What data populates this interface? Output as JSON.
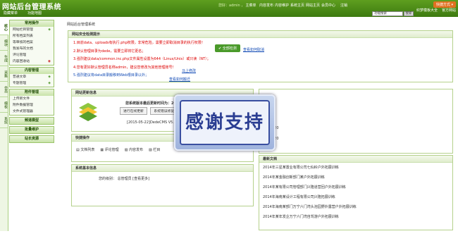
{
  "header": {
    "logo": "网站后台管理系统",
    "subnav": [
      "隐藏菜单",
      "功能地图"
    ],
    "user": "您好：admin ，",
    "nav": [
      "主菜单",
      "内容发布",
      "内容维护",
      "系统主页",
      "网站主页",
      "会员中心",
      "注销"
    ],
    "quick_label": "快捷方式 ▾",
    "quick_links": [
      "织梦模板大全",
      "官方网站"
    ],
    "search_value": "功能搜索",
    "search_button": "搜索"
  },
  "left_tabs": [
    "核心",
    "模块",
    "生成",
    "采集",
    "会员",
    "模板",
    "系统"
  ],
  "sidebar": [
    {
      "title": "常用操作",
      "items": [
        "网站栏目管理",
        "所有档案列表",
        "等审核的档案",
        "我发布的文档",
        "评论管理",
        "内容回收站"
      ]
    },
    {
      "title": "内容管理",
      "items": [
        "普通文章",
        "专题管理"
      ]
    },
    {
      "title": "附件管理",
      "items": [
        "上传新文件",
        "附件数据管理",
        "文件式管理器"
      ]
    },
    {
      "title": "频道模型",
      "items": []
    },
    {
      "title": "批量维护",
      "items": []
    },
    {
      "title": "站长资源",
      "items": []
    }
  ],
  "breadcrumb": "网站后台管理系统",
  "security": {
    "title": "网站安全检测提示",
    "lines": [
      "1.目前data、uploads有执行.php权限，非常危险，需要立即取消目录的执行权限！",
      "2.默认管理目录为dede，需要立即将它更名；",
      "3.强烈建议data/common.inc.php文件属性设置为644（Linux/Unix）或只读（NT）；",
      "4.您有更好默认管理员名称admin，建议您修改为其他管理账号！",
      "5.强烈建议将data目录搬移到Web根目录以外；"
    ],
    "fix_links": [
      "马上修改",
      "查看如何搬迁"
    ],
    "ok_button": "✔ 全部检测",
    "howto": "查看如何取消"
  },
  "updates": {
    "title": "网站更新信息",
    "headline": "您系统版本最后更新时间为：20",
    "btn1": "进行在线更新",
    "btn2": "系统错误修复",
    "note": "[2015-05-22]DedeCMS V5.7SP1 T"
  },
  "quick": {
    "title": "快捷操作",
    "items": [
      "文档列表",
      "评论管理",
      "内容发布",
      "栏目"
    ]
  },
  "sysinfo": {
    "title": "系统基本信息",
    "line": "您的级别：  总管理员  [查看更多]"
  },
  "stats": [
    "1",
    "120",
    "120",
    "0"
  ],
  "news": {
    "title": "最新文档",
    "items": [
      "2014年三星某置业有限公司七仙岭户外拓展训练",
      "2014年某金融创新部门某户外拓展训练",
      "2014年某有限公司管理部门兴隆道营回户外拓展训练",
      "2014年海南某设计工程有限公司兴隆拓展训练",
      "2014年海南某部门万宁六门湾头泡园野外露营户外拓展训练",
      "2014年某年发企万宁六门湾自驾游户外拓展训练"
    ]
  },
  "overlay_text": "感谢支持"
}
